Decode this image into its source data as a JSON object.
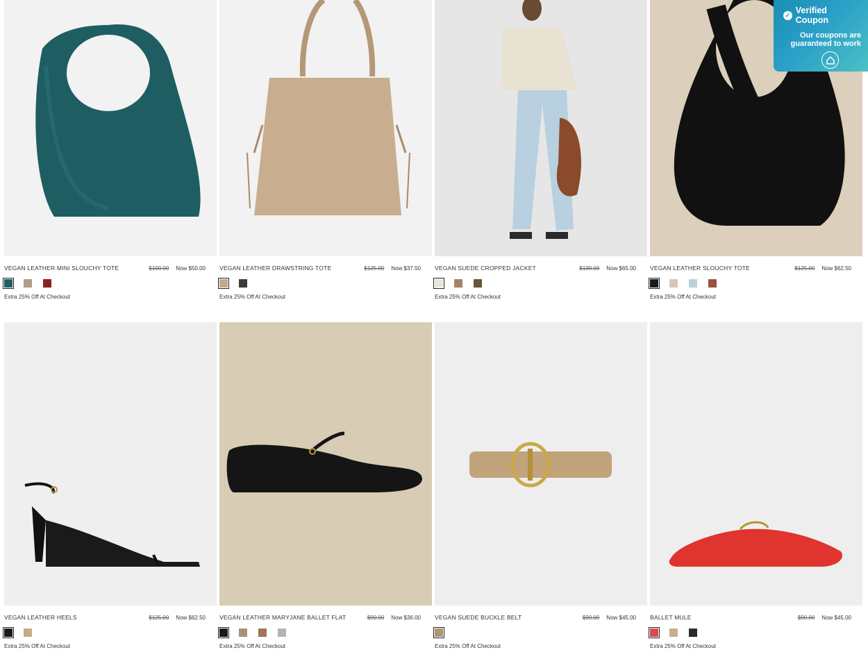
{
  "products": [
    {
      "name": "VEGAN LEATHER MINI SLOUCHY TOTE",
      "was": "$100.00",
      "now": "Now $50.00",
      "promo": "Extra 25% Off At Checkout",
      "swatches": [
        "#1f5f66",
        "#b29d88",
        "#8b1f22"
      ],
      "selected": 0
    },
    {
      "name": "VEGAN LEATHER DRAWSTRING TOTE",
      "was": "$125.00",
      "now": "Now $37.50",
      "promo": "Extra 25% Off At Checkout",
      "swatches": [
        "#c4a88b",
        "#3b3b3b"
      ],
      "selected": 0
    },
    {
      "name": "VEGAN SUEDE CROPPED JACKET",
      "was": "$130.00",
      "now": "Now $65.00",
      "promo": "Extra 25% Off At Checkout",
      "swatches": [
        "#eae6dc",
        "#a48466",
        "#6b5536"
      ],
      "selected": 0
    },
    {
      "name": "VEGAN LEATHER SLOUCHY TOTE",
      "was": "$125.00",
      "now": "Now $62.50",
      "promo": "Extra 25% Off At Checkout",
      "swatches": [
        "#1a1a1a",
        "#d7c7b8",
        "#b7d1d4",
        "#98553a"
      ],
      "selected": 0
    },
    {
      "name": "VEGAN LEATHER HEELS",
      "was": "$125.00",
      "now": "Now $62.50",
      "promo": "Extra 25% Off At Checkout",
      "swatches": [
        "#1a1a1a",
        "#c3ad86"
      ],
      "selected": 0
    },
    {
      "name": "VEGAN LEATHER MARYJANE BALLET FLAT",
      "was": "$90.00",
      "now": "Now $36.00",
      "promo": "Extra 25% Off At Checkout",
      "swatches": [
        "#1a1a1a",
        "#a89274",
        "#a0735a",
        "#b3b3b3"
      ],
      "selected": 0
    },
    {
      "name": "VEGAN SUEDE BUCKLE BELT",
      "was": "$90.00",
      "now": "Now $45.00",
      "promo": "Extra 25% Off At Checkout",
      "swatches": [
        "#b29574"
      ],
      "selected": 0
    },
    {
      "name": "BALLET MULE",
      "was": "$90.00",
      "now": "Now $45.00",
      "promo": "Extra 25% Off At Checkout",
      "swatches": [
        "#d94b4b",
        "#c7ae8c",
        "#2b2b2b"
      ],
      "selected": 0
    }
  ],
  "coupon": {
    "title": "Verified Coupon",
    "message": "Our coupons are guaranteed to work",
    "icon": "home-icon",
    "gradient_start": "#1a8fb3",
    "gradient_end": "#4cc1c4"
  }
}
